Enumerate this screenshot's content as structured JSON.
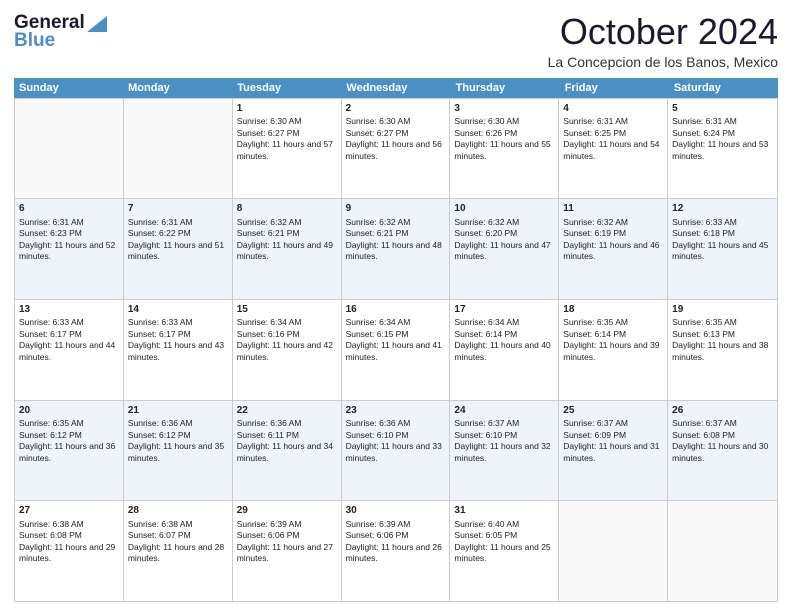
{
  "header": {
    "logo_general": "General",
    "logo_blue": "Blue",
    "month_title": "October 2024",
    "location": "La Concepcion de los Banos, Mexico"
  },
  "calendar": {
    "headers": [
      "Sunday",
      "Monday",
      "Tuesday",
      "Wednesday",
      "Thursday",
      "Friday",
      "Saturday"
    ],
    "rows": [
      [
        {
          "day": "",
          "text": ""
        },
        {
          "day": "",
          "text": ""
        },
        {
          "day": "1",
          "text": "Sunrise: 6:30 AM\nSunset: 6:27 PM\nDaylight: 11 hours and 57 minutes."
        },
        {
          "day": "2",
          "text": "Sunrise: 6:30 AM\nSunset: 6:27 PM\nDaylight: 11 hours and 56 minutes."
        },
        {
          "day": "3",
          "text": "Sunrise: 6:30 AM\nSunset: 6:26 PM\nDaylight: 11 hours and 55 minutes."
        },
        {
          "day": "4",
          "text": "Sunrise: 6:31 AM\nSunset: 6:25 PM\nDaylight: 11 hours and 54 minutes."
        },
        {
          "day": "5",
          "text": "Sunrise: 6:31 AM\nSunset: 6:24 PM\nDaylight: 11 hours and 53 minutes."
        }
      ],
      [
        {
          "day": "6",
          "text": "Sunrise: 6:31 AM\nSunset: 6:23 PM\nDaylight: 11 hours and 52 minutes."
        },
        {
          "day": "7",
          "text": "Sunrise: 6:31 AM\nSunset: 6:22 PM\nDaylight: 11 hours and 51 minutes."
        },
        {
          "day": "8",
          "text": "Sunrise: 6:32 AM\nSunset: 6:21 PM\nDaylight: 11 hours and 49 minutes."
        },
        {
          "day": "9",
          "text": "Sunrise: 6:32 AM\nSunset: 6:21 PM\nDaylight: 11 hours and 48 minutes."
        },
        {
          "day": "10",
          "text": "Sunrise: 6:32 AM\nSunset: 6:20 PM\nDaylight: 11 hours and 47 minutes."
        },
        {
          "day": "11",
          "text": "Sunrise: 6:32 AM\nSunset: 6:19 PM\nDaylight: 11 hours and 46 minutes."
        },
        {
          "day": "12",
          "text": "Sunrise: 6:33 AM\nSunset: 6:18 PM\nDaylight: 11 hours and 45 minutes."
        }
      ],
      [
        {
          "day": "13",
          "text": "Sunrise: 6:33 AM\nSunset: 6:17 PM\nDaylight: 11 hours and 44 minutes."
        },
        {
          "day": "14",
          "text": "Sunrise: 6:33 AM\nSunset: 6:17 PM\nDaylight: 11 hours and 43 minutes."
        },
        {
          "day": "15",
          "text": "Sunrise: 6:34 AM\nSunset: 6:16 PM\nDaylight: 11 hours and 42 minutes."
        },
        {
          "day": "16",
          "text": "Sunrise: 6:34 AM\nSunset: 6:15 PM\nDaylight: 11 hours and 41 minutes."
        },
        {
          "day": "17",
          "text": "Sunrise: 6:34 AM\nSunset: 6:14 PM\nDaylight: 11 hours and 40 minutes."
        },
        {
          "day": "18",
          "text": "Sunrise: 6:35 AM\nSunset: 6:14 PM\nDaylight: 11 hours and 39 minutes."
        },
        {
          "day": "19",
          "text": "Sunrise: 6:35 AM\nSunset: 6:13 PM\nDaylight: 11 hours and 38 minutes."
        }
      ],
      [
        {
          "day": "20",
          "text": "Sunrise: 6:35 AM\nSunset: 6:12 PM\nDaylight: 11 hours and 36 minutes."
        },
        {
          "day": "21",
          "text": "Sunrise: 6:36 AM\nSunset: 6:12 PM\nDaylight: 11 hours and 35 minutes."
        },
        {
          "day": "22",
          "text": "Sunrise: 6:36 AM\nSunset: 6:11 PM\nDaylight: 11 hours and 34 minutes."
        },
        {
          "day": "23",
          "text": "Sunrise: 6:36 AM\nSunset: 6:10 PM\nDaylight: 11 hours and 33 minutes."
        },
        {
          "day": "24",
          "text": "Sunrise: 6:37 AM\nSunset: 6:10 PM\nDaylight: 11 hours and 32 minutes."
        },
        {
          "day": "25",
          "text": "Sunrise: 6:37 AM\nSunset: 6:09 PM\nDaylight: 11 hours and 31 minutes."
        },
        {
          "day": "26",
          "text": "Sunrise: 6:37 AM\nSunset: 6:08 PM\nDaylight: 11 hours and 30 minutes."
        }
      ],
      [
        {
          "day": "27",
          "text": "Sunrise: 6:38 AM\nSunset: 6:08 PM\nDaylight: 11 hours and 29 minutes."
        },
        {
          "day": "28",
          "text": "Sunrise: 6:38 AM\nSunset: 6:07 PM\nDaylight: 11 hours and 28 minutes."
        },
        {
          "day": "29",
          "text": "Sunrise: 6:39 AM\nSunset: 6:06 PM\nDaylight: 11 hours and 27 minutes."
        },
        {
          "day": "30",
          "text": "Sunrise: 6:39 AM\nSunset: 6:06 PM\nDaylight: 11 hours and 26 minutes."
        },
        {
          "day": "31",
          "text": "Sunrise: 6:40 AM\nSunset: 6:05 PM\nDaylight: 11 hours and 25 minutes."
        },
        {
          "day": "",
          "text": ""
        },
        {
          "day": "",
          "text": ""
        }
      ]
    ]
  }
}
